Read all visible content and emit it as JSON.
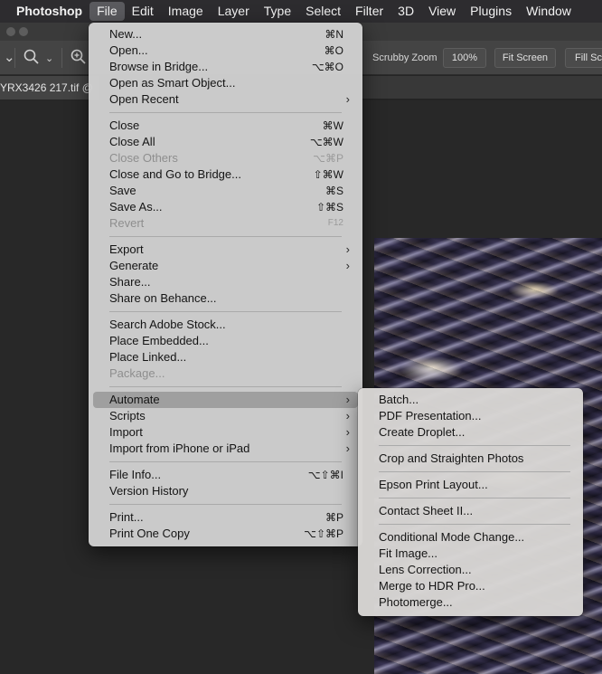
{
  "menubar": {
    "app": "Photoshop",
    "items": [
      "File",
      "Edit",
      "Image",
      "Layer",
      "Type",
      "Select",
      "Filter",
      "3D",
      "View",
      "Plugins",
      "Window"
    ]
  },
  "options_bar": {
    "scrubby_zoom": "Scrubby Zoom",
    "zoom_value": "100%",
    "fit_screen": "Fit Screen",
    "fill_screen": "Fill Scr"
  },
  "document_tab": "YRX3426 217.tif @",
  "file_menu": {
    "groups": [
      [
        {
          "label": "New...",
          "shortcut": "⌘N"
        },
        {
          "label": "Open...",
          "shortcut": "⌘O"
        },
        {
          "label": "Browse in Bridge...",
          "shortcut": "⌥⌘O"
        },
        {
          "label": "Open as Smart Object...",
          "shortcut": ""
        },
        {
          "label": "Open Recent",
          "shortcut": "",
          "submenu": true
        }
      ],
      [
        {
          "label": "Close",
          "shortcut": "⌘W"
        },
        {
          "label": "Close All",
          "shortcut": "⌥⌘W"
        },
        {
          "label": "Close Others",
          "shortcut": "⌥⌘P",
          "disabled": true
        },
        {
          "label": "Close and Go to Bridge...",
          "shortcut": "⇧⌘W"
        },
        {
          "label": "Save",
          "shortcut": "⌘S"
        },
        {
          "label": "Save As...",
          "shortcut": "⇧⌘S"
        },
        {
          "label": "Revert",
          "shortcut": "F12",
          "disabled": true
        }
      ],
      [
        {
          "label": "Export",
          "shortcut": "",
          "submenu": true
        },
        {
          "label": "Generate",
          "shortcut": "",
          "submenu": true
        },
        {
          "label": "Share...",
          "shortcut": ""
        },
        {
          "label": "Share on Behance...",
          "shortcut": ""
        }
      ],
      [
        {
          "label": "Search Adobe Stock...",
          "shortcut": ""
        },
        {
          "label": "Place Embedded...",
          "shortcut": ""
        },
        {
          "label": "Place Linked...",
          "shortcut": ""
        },
        {
          "label": "Package...",
          "shortcut": "",
          "disabled": true
        }
      ],
      [
        {
          "label": "Automate",
          "shortcut": "",
          "submenu": true,
          "highlighted": true
        },
        {
          "label": "Scripts",
          "shortcut": "",
          "submenu": true
        },
        {
          "label": "Import",
          "shortcut": "",
          "submenu": true
        },
        {
          "label": "Import from iPhone or iPad",
          "shortcut": "",
          "submenu": true
        }
      ],
      [
        {
          "label": "File Info...",
          "shortcut": "⌥⇧⌘I"
        },
        {
          "label": "Version History",
          "shortcut": ""
        }
      ],
      [
        {
          "label": "Print...",
          "shortcut": "⌘P"
        },
        {
          "label": "Print One Copy",
          "shortcut": "⌥⇧⌘P"
        }
      ]
    ]
  },
  "automate_menu": {
    "groups": [
      [
        "Batch...",
        "PDF Presentation...",
        "Create Droplet..."
      ],
      [
        "Crop and Straighten Photos"
      ],
      [
        "Epson Print Layout..."
      ],
      [
        "Contact Sheet II..."
      ],
      [
        "Conditional Mode Change...",
        "Fit Image...",
        "Lens Correction...",
        "Merge to HDR Pro...",
        "Photomerge..."
      ]
    ]
  }
}
